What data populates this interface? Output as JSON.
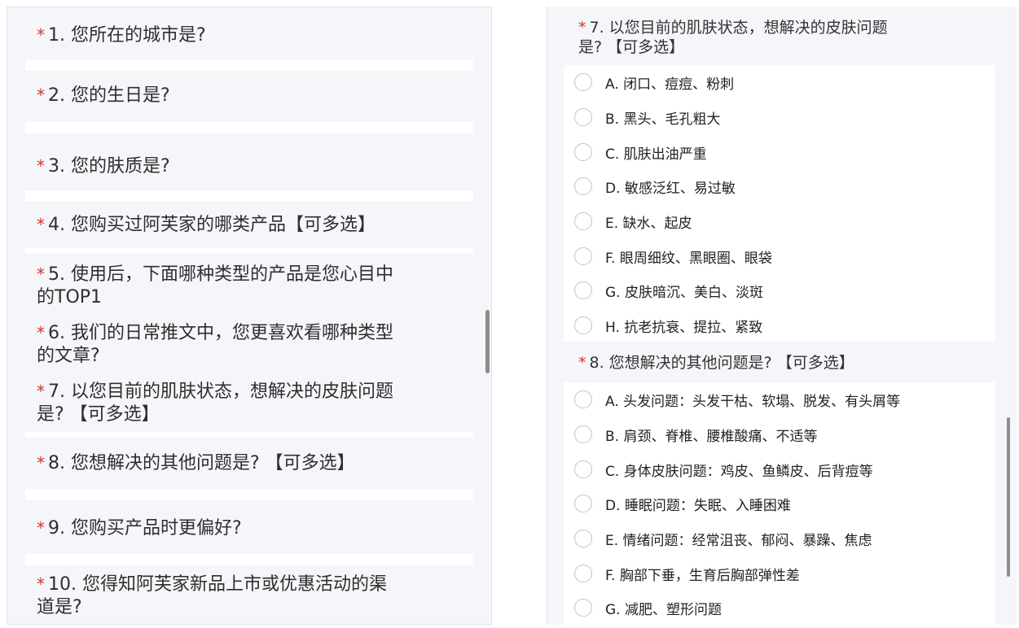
{
  "required_mark": "*",
  "colors": {
    "required": "#d9312f",
    "panel_bg": "#f4f6f9",
    "option_bg": "#ffffff"
  },
  "left_panel": {
    "questions": [
      {
        "label": "1. 您所在的城市是?"
      },
      {
        "label": "2. 您的生日是?"
      },
      {
        "label": "3. 您的肤质是?"
      },
      {
        "label": "4. 您购买过阿芙家的哪类产品【可多选】"
      },
      {
        "label_line1": "5. 使用后，下面哪种类型的产品是您心目中",
        "label_line2": "的TOP1"
      },
      {
        "label_line1": "6. 我们的日常推文中，您更喜欢看哪种类型",
        "label_line2": "的文章?"
      },
      {
        "label_line1": "7. 以您目前的肌肤状态，想解决的皮肤问题",
        "label_line2": "是? 【可多选】"
      },
      {
        "label": "8. 您想解决的其他问题是? 【可多选】"
      },
      {
        "label": "9. 您购买产品时更偏好?"
      },
      {
        "label_line1": "10. 您得知阿芙家新品上市或优惠活动的渠",
        "label_line2": "道是?"
      }
    ]
  },
  "right_panel": {
    "q7": {
      "label_line1": "7. 以您目前的肌肤状态，想解决的皮肤问题",
      "label_line2": "是? 【可多选】",
      "options": [
        "A. 闭口、痘痘、粉刺",
        "B. 黑头、毛孔粗大",
        "C. 肌肤出油严重",
        "D. 敏感泛红、易过敏",
        "E. 缺水、起皮",
        "F. 眼周细纹、黑眼圈、眼袋",
        "G. 皮肤暗沉、美白、淡斑",
        "H. 抗老抗衰、提拉、紧致"
      ]
    },
    "q8": {
      "label": "8. 您想解决的其他问题是? 【可多选】",
      "options": [
        "A. 头发问题：头发干枯、软塌、脱发、有头屑等",
        "B. 肩颈、脊椎、腰椎酸痛、不适等",
        "C. 身体皮肤问题：鸡皮、鱼鳞皮、后背痘等",
        "D. 睡眠问题：失眠、入睡困难",
        "E. 情绪问题：经常沮丧、郁闷、暴躁、焦虑",
        "F. 胸部下垂，生育后胸部弹性差",
        "G. 减肥、塑形问题"
      ]
    }
  }
}
